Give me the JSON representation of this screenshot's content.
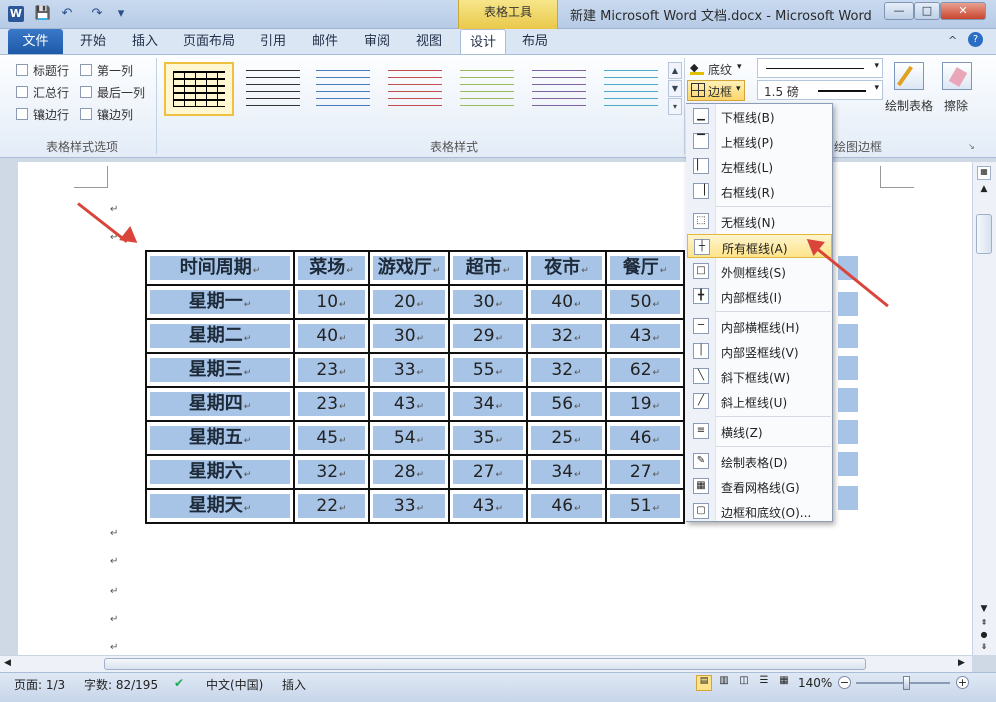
{
  "window": {
    "title": "新建 Microsoft Word 文档.docx - Microsoft Word",
    "context_group": "表格工具",
    "app_icon": "W"
  },
  "qat": {
    "save": "💾",
    "undo": "↶",
    "redo": "↷",
    "more": "▾"
  },
  "win_controls": {
    "minimize": "—",
    "maximize": "□",
    "close": "✕"
  },
  "tabs": [
    "文件",
    "开始",
    "插入",
    "页面布局",
    "引用",
    "邮件",
    "审阅",
    "视图",
    "设计",
    "布局"
  ],
  "help_icons": {
    "collapse": "^",
    "help": "?"
  },
  "ribbon": {
    "style_options": {
      "label": "表格样式选项",
      "items": [
        "标题行",
        "第一列",
        "汇总行",
        "最后一列",
        "镶边行",
        "镶边列"
      ]
    },
    "styles": {
      "label": "表格样式"
    },
    "shading_label": "底纹",
    "border_label": "边框",
    "pen_weight": "1.5 磅",
    "draw_table_label": "绘制表格",
    "eraser_label": "擦除",
    "draw_borders_label": "绘图边框"
  },
  "table": {
    "headers": [
      "时间周期",
      "菜场",
      "游戏厅",
      "超市",
      "夜市",
      "餐厅"
    ],
    "rows": [
      [
        "星期一",
        "10",
        "20",
        "30",
        "40",
        "50"
      ],
      [
        "星期二",
        "40",
        "30",
        "29",
        "32",
        "43"
      ],
      [
        "星期三",
        "23",
        "33",
        "55",
        "32",
        "62"
      ],
      [
        "星期四",
        "23",
        "43",
        "34",
        "56",
        "19"
      ],
      [
        "星期五",
        "45",
        "54",
        "35",
        "25",
        "46"
      ],
      [
        "星期六",
        "32",
        "28",
        "27",
        "34",
        "27"
      ],
      [
        "星期天",
        "22",
        "33",
        "43",
        "46",
        "51"
      ]
    ],
    "cell_mark": "↵"
  },
  "menu": {
    "items": [
      {
        "label": "下框线(B)",
        "group": 1
      },
      {
        "label": "上框线(P)",
        "group": 1
      },
      {
        "label": "左框线(L)",
        "group": 1
      },
      {
        "label": "右框线(R)",
        "group": 1
      },
      {
        "label": "无框线(N)",
        "group": 2
      },
      {
        "label": "所有框线(A)",
        "group": 2,
        "highlight": true
      },
      {
        "label": "外侧框线(S)",
        "group": 2
      },
      {
        "label": "内部框线(I)",
        "group": 2
      },
      {
        "label": "内部横框线(H)",
        "group": 3
      },
      {
        "label": "内部竖框线(V)",
        "group": 3
      },
      {
        "label": "斜下框线(W)",
        "group": 3
      },
      {
        "label": "斜上框线(U)",
        "group": 3
      },
      {
        "label": "横线(Z)",
        "group": 4
      },
      {
        "label": "绘制表格(D)",
        "group": 5
      },
      {
        "label": "查看网格线(G)",
        "group": 5
      },
      {
        "label": "边框和底纹(O)...",
        "group": 5
      }
    ]
  },
  "status": {
    "page": "页面: 1/3",
    "words": "字数: 82/195",
    "language": "中文(中国)",
    "mode": "插入",
    "zoom": "140%"
  },
  "colors": {
    "cell_fill": "#a7c4e6",
    "arrow": "#d9453a",
    "highlight": "#fde38a"
  }
}
